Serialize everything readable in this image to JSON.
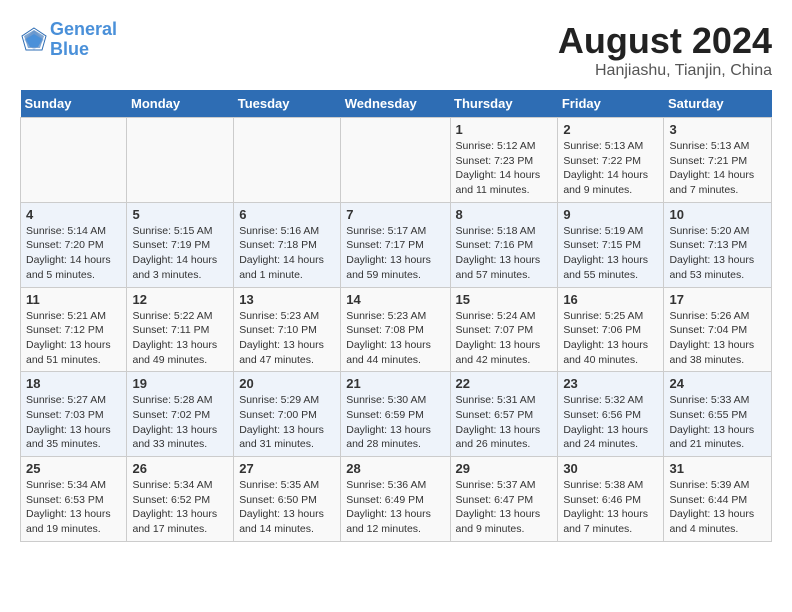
{
  "logo": {
    "line1": "General",
    "line2": "Blue"
  },
  "title": "August 2024",
  "location": "Hanjiashu, Tianjin, China",
  "weekdays": [
    "Sunday",
    "Monday",
    "Tuesday",
    "Wednesday",
    "Thursday",
    "Friday",
    "Saturday"
  ],
  "weeks": [
    [
      {
        "day": "",
        "info": ""
      },
      {
        "day": "",
        "info": ""
      },
      {
        "day": "",
        "info": ""
      },
      {
        "day": "",
        "info": ""
      },
      {
        "day": "1",
        "info": "Sunrise: 5:12 AM\nSunset: 7:23 PM\nDaylight: 14 hours\nand 11 minutes."
      },
      {
        "day": "2",
        "info": "Sunrise: 5:13 AM\nSunset: 7:22 PM\nDaylight: 14 hours\nand 9 minutes."
      },
      {
        "day": "3",
        "info": "Sunrise: 5:13 AM\nSunset: 7:21 PM\nDaylight: 14 hours\nand 7 minutes."
      }
    ],
    [
      {
        "day": "4",
        "info": "Sunrise: 5:14 AM\nSunset: 7:20 PM\nDaylight: 14 hours\nand 5 minutes."
      },
      {
        "day": "5",
        "info": "Sunrise: 5:15 AM\nSunset: 7:19 PM\nDaylight: 14 hours\nand 3 minutes."
      },
      {
        "day": "6",
        "info": "Sunrise: 5:16 AM\nSunset: 7:18 PM\nDaylight: 14 hours\nand 1 minute."
      },
      {
        "day": "7",
        "info": "Sunrise: 5:17 AM\nSunset: 7:17 PM\nDaylight: 13 hours\nand 59 minutes."
      },
      {
        "day": "8",
        "info": "Sunrise: 5:18 AM\nSunset: 7:16 PM\nDaylight: 13 hours\nand 57 minutes."
      },
      {
        "day": "9",
        "info": "Sunrise: 5:19 AM\nSunset: 7:15 PM\nDaylight: 13 hours\nand 55 minutes."
      },
      {
        "day": "10",
        "info": "Sunrise: 5:20 AM\nSunset: 7:13 PM\nDaylight: 13 hours\nand 53 minutes."
      }
    ],
    [
      {
        "day": "11",
        "info": "Sunrise: 5:21 AM\nSunset: 7:12 PM\nDaylight: 13 hours\nand 51 minutes."
      },
      {
        "day": "12",
        "info": "Sunrise: 5:22 AM\nSunset: 7:11 PM\nDaylight: 13 hours\nand 49 minutes."
      },
      {
        "day": "13",
        "info": "Sunrise: 5:23 AM\nSunset: 7:10 PM\nDaylight: 13 hours\nand 47 minutes."
      },
      {
        "day": "14",
        "info": "Sunrise: 5:23 AM\nSunset: 7:08 PM\nDaylight: 13 hours\nand 44 minutes."
      },
      {
        "day": "15",
        "info": "Sunrise: 5:24 AM\nSunset: 7:07 PM\nDaylight: 13 hours\nand 42 minutes."
      },
      {
        "day": "16",
        "info": "Sunrise: 5:25 AM\nSunset: 7:06 PM\nDaylight: 13 hours\nand 40 minutes."
      },
      {
        "day": "17",
        "info": "Sunrise: 5:26 AM\nSunset: 7:04 PM\nDaylight: 13 hours\nand 38 minutes."
      }
    ],
    [
      {
        "day": "18",
        "info": "Sunrise: 5:27 AM\nSunset: 7:03 PM\nDaylight: 13 hours\nand 35 minutes."
      },
      {
        "day": "19",
        "info": "Sunrise: 5:28 AM\nSunset: 7:02 PM\nDaylight: 13 hours\nand 33 minutes."
      },
      {
        "day": "20",
        "info": "Sunrise: 5:29 AM\nSunset: 7:00 PM\nDaylight: 13 hours\nand 31 minutes."
      },
      {
        "day": "21",
        "info": "Sunrise: 5:30 AM\nSunset: 6:59 PM\nDaylight: 13 hours\nand 28 minutes."
      },
      {
        "day": "22",
        "info": "Sunrise: 5:31 AM\nSunset: 6:57 PM\nDaylight: 13 hours\nand 26 minutes."
      },
      {
        "day": "23",
        "info": "Sunrise: 5:32 AM\nSunset: 6:56 PM\nDaylight: 13 hours\nand 24 minutes."
      },
      {
        "day": "24",
        "info": "Sunrise: 5:33 AM\nSunset: 6:55 PM\nDaylight: 13 hours\nand 21 minutes."
      }
    ],
    [
      {
        "day": "25",
        "info": "Sunrise: 5:34 AM\nSunset: 6:53 PM\nDaylight: 13 hours\nand 19 minutes."
      },
      {
        "day": "26",
        "info": "Sunrise: 5:34 AM\nSunset: 6:52 PM\nDaylight: 13 hours\nand 17 minutes."
      },
      {
        "day": "27",
        "info": "Sunrise: 5:35 AM\nSunset: 6:50 PM\nDaylight: 13 hours\nand 14 minutes."
      },
      {
        "day": "28",
        "info": "Sunrise: 5:36 AM\nSunset: 6:49 PM\nDaylight: 13 hours\nand 12 minutes."
      },
      {
        "day": "29",
        "info": "Sunrise: 5:37 AM\nSunset: 6:47 PM\nDaylight: 13 hours\nand 9 minutes."
      },
      {
        "day": "30",
        "info": "Sunrise: 5:38 AM\nSunset: 6:46 PM\nDaylight: 13 hours\nand 7 minutes."
      },
      {
        "day": "31",
        "info": "Sunrise: 5:39 AM\nSunset: 6:44 PM\nDaylight: 13 hours\nand 4 minutes."
      }
    ]
  ]
}
